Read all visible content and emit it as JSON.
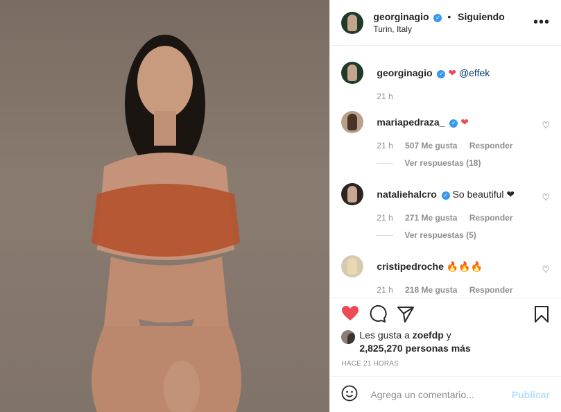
{
  "header": {
    "username": "georginagio",
    "dot": "•",
    "following": "Siguiendo",
    "location": "Turin, Italy",
    "more": "•••"
  },
  "caption": {
    "username": "georginagio",
    "emoji": "❤",
    "mention": "@effek",
    "time": "21 h"
  },
  "comments": [
    {
      "username": "mariapedraza_",
      "text": "❤",
      "time": "21 h",
      "likes": "507 Me gusta",
      "reply": "Responder",
      "replies": "Ver respuestas (18)"
    },
    {
      "username": "nataliehalcro",
      "text": "So beautiful ❤",
      "time": "21 h",
      "likes": "271 Me gusta",
      "reply": "Responder",
      "replies": "Ver respuestas (5)"
    },
    {
      "username": "cristipedroche",
      "text": "🔥🔥🔥",
      "time": "21 h",
      "likes": "218 Me gusta",
      "reply": "Responder"
    }
  ],
  "likes": {
    "prefix": "Les gusta a",
    "user": "zoefdp",
    "conj": "y",
    "count": "2,825,270 personas más"
  },
  "posted": "HACE 21 HORAS",
  "add_comment": {
    "placeholder": "Agrega un comentario...",
    "publish": "Publicar"
  },
  "icons": {
    "like": "heart-filled-icon",
    "comment": "comment-icon",
    "share": "send-icon",
    "save": "bookmark-icon",
    "emoji": "smiley-icon"
  },
  "colors": {
    "like": "#ed4956",
    "verified": "#3897f0",
    "publish": "#b2dffc"
  }
}
